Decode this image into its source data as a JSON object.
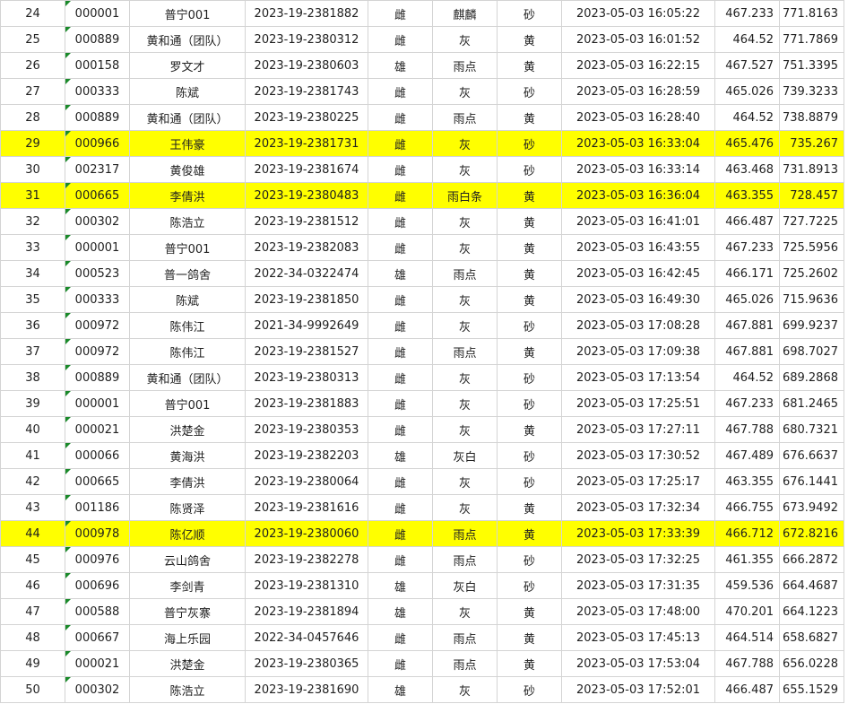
{
  "sheet": {
    "highlight_color": "#ffff00",
    "rows": [
      {
        "rank": "24",
        "id": "000001",
        "name": "普宁001",
        "ring": "2023-19-2381882",
        "sex": "雌",
        "color": "麒麟",
        "eye": "砂",
        "time": "2023-05-03  16:05:22",
        "distance": "467.233",
        "speed": "771.8163",
        "highlight": false
      },
      {
        "rank": "25",
        "id": "000889",
        "name": "黄和通（团队）",
        "ring": "2023-19-2380312",
        "sex": "雌",
        "color": "灰",
        "eye": "黄",
        "time": "2023-05-03  16:01:52",
        "distance": "464.52",
        "speed": "771.7869",
        "highlight": false
      },
      {
        "rank": "26",
        "id": "000158",
        "name": "罗文才",
        "ring": "2023-19-2380603",
        "sex": "雄",
        "color": "雨点",
        "eye": "黄",
        "time": "2023-05-03  16:22:15",
        "distance": "467.527",
        "speed": "751.3395",
        "highlight": false
      },
      {
        "rank": "27",
        "id": "000333",
        "name": "陈斌",
        "ring": "2023-19-2381743",
        "sex": "雌",
        "color": "灰",
        "eye": "砂",
        "time": "2023-05-03  16:28:59",
        "distance": "465.026",
        "speed": "739.3233",
        "highlight": false
      },
      {
        "rank": "28",
        "id": "000889",
        "name": "黄和通（团队）",
        "ring": "2023-19-2380225",
        "sex": "雌",
        "color": "雨点",
        "eye": "黄",
        "time": "2023-05-03  16:28:40",
        "distance": "464.52",
        "speed": "738.8879",
        "highlight": false
      },
      {
        "rank": "29",
        "id": "000966",
        "name": "王伟豪",
        "ring": "2023-19-2381731",
        "sex": "雌",
        "color": "灰",
        "eye": "砂",
        "time": "2023-05-03  16:33:04",
        "distance": "465.476",
        "speed": "735.267",
        "highlight": true
      },
      {
        "rank": "30",
        "id": "002317",
        "name": "黄俊雄",
        "ring": "2023-19-2381674",
        "sex": "雌",
        "color": "灰",
        "eye": "砂",
        "time": "2023-05-03  16:33:14",
        "distance": "463.468",
        "speed": "731.8913",
        "highlight": false
      },
      {
        "rank": "31",
        "id": "000665",
        "name": "李倩洪",
        "ring": "2023-19-2380483",
        "sex": "雌",
        "color": "雨白条",
        "eye": "黄",
        "time": "2023-05-03  16:36:04",
        "distance": "463.355",
        "speed": "728.457",
        "highlight": true
      },
      {
        "rank": "32",
        "id": "000302",
        "name": "陈浩立",
        "ring": "2023-19-2381512",
        "sex": "雌",
        "color": "灰",
        "eye": "黄",
        "time": "2023-05-03  16:41:01",
        "distance": "466.487",
        "speed": "727.7225",
        "highlight": false
      },
      {
        "rank": "33",
        "id": "000001",
        "name": "普宁001",
        "ring": "2023-19-2382083",
        "sex": "雌",
        "color": "灰",
        "eye": "黄",
        "time": "2023-05-03  16:43:55",
        "distance": "467.233",
        "speed": "725.5956",
        "highlight": false
      },
      {
        "rank": "34",
        "id": "000523",
        "name": "普一鸽舍",
        "ring": "2022-34-0322474",
        "sex": "雄",
        "color": "雨点",
        "eye": "黄",
        "time": "2023-05-03  16:42:45",
        "distance": "466.171",
        "speed": "725.2602",
        "highlight": false
      },
      {
        "rank": "35",
        "id": "000333",
        "name": "陈斌",
        "ring": "2023-19-2381850",
        "sex": "雌",
        "color": "灰",
        "eye": "黄",
        "time": "2023-05-03  16:49:30",
        "distance": "465.026",
        "speed": "715.9636",
        "highlight": false
      },
      {
        "rank": "36",
        "id": "000972",
        "name": "陈伟江",
        "ring": "2021-34-9992649",
        "sex": "雌",
        "color": "灰",
        "eye": "砂",
        "time": "2023-05-03  17:08:28",
        "distance": "467.881",
        "speed": "699.9237",
        "highlight": false
      },
      {
        "rank": "37",
        "id": "000972",
        "name": "陈伟江",
        "ring": "2023-19-2381527",
        "sex": "雌",
        "color": "雨点",
        "eye": "黄",
        "time": "2023-05-03  17:09:38",
        "distance": "467.881",
        "speed": "698.7027",
        "highlight": false
      },
      {
        "rank": "38",
        "id": "000889",
        "name": "黄和通（团队）",
        "ring": "2023-19-2380313",
        "sex": "雌",
        "color": "灰",
        "eye": "砂",
        "time": "2023-05-03  17:13:54",
        "distance": "464.52",
        "speed": "689.2868",
        "highlight": false
      },
      {
        "rank": "39",
        "id": "000001",
        "name": "普宁001",
        "ring": "2023-19-2381883",
        "sex": "雌",
        "color": "灰",
        "eye": "砂",
        "time": "2023-05-03  17:25:51",
        "distance": "467.233",
        "speed": "681.2465",
        "highlight": false
      },
      {
        "rank": "40",
        "id": "000021",
        "name": "洪楚金",
        "ring": "2023-19-2380353",
        "sex": "雌",
        "color": "灰",
        "eye": "黄",
        "time": "2023-05-03  17:27:11",
        "distance": "467.788",
        "speed": "680.7321",
        "highlight": false
      },
      {
        "rank": "41",
        "id": "000066",
        "name": "黄海洪",
        "ring": "2023-19-2382203",
        "sex": "雄",
        "color": "灰白",
        "eye": "砂",
        "time": "2023-05-03  17:30:52",
        "distance": "467.489",
        "speed": "676.6637",
        "highlight": false
      },
      {
        "rank": "42",
        "id": "000665",
        "name": "李倩洪",
        "ring": "2023-19-2380064",
        "sex": "雌",
        "color": "灰",
        "eye": "砂",
        "time": "2023-05-03  17:25:17",
        "distance": "463.355",
        "speed": "676.1441",
        "highlight": false
      },
      {
        "rank": "43",
        "id": "001186",
        "name": "陈贤泽",
        "ring": "2023-19-2381616",
        "sex": "雌",
        "color": "灰",
        "eye": "黄",
        "time": "2023-05-03  17:32:34",
        "distance": "466.755",
        "speed": "673.9492",
        "highlight": false
      },
      {
        "rank": "44",
        "id": "000978",
        "name": "陈亿顺",
        "ring": "2023-19-2380060",
        "sex": "雌",
        "color": "雨点",
        "eye": "黄",
        "time": "2023-05-03  17:33:39",
        "distance": "466.712",
        "speed": "672.8216",
        "highlight": true
      },
      {
        "rank": "45",
        "id": "000976",
        "name": "云山鸽舍",
        "ring": "2023-19-2382278",
        "sex": "雌",
        "color": "雨点",
        "eye": "砂",
        "time": "2023-05-03  17:32:25",
        "distance": "461.355",
        "speed": "666.2872",
        "highlight": false
      },
      {
        "rank": "46",
        "id": "000696",
        "name": "李剑青",
        "ring": "2023-19-2381310",
        "sex": "雄",
        "color": "灰白",
        "eye": "砂",
        "time": "2023-05-03  17:31:35",
        "distance": "459.536",
        "speed": "664.4687",
        "highlight": false
      },
      {
        "rank": "47",
        "id": "000588",
        "name": "普宁灰寨",
        "ring": "2023-19-2381894",
        "sex": "雄",
        "color": "灰",
        "eye": "黄",
        "time": "2023-05-03  17:48:00",
        "distance": "470.201",
        "speed": "664.1223",
        "highlight": false
      },
      {
        "rank": "48",
        "id": "000667",
        "name": "海上乐园",
        "ring": "2022-34-0457646",
        "sex": "雌",
        "color": "雨点",
        "eye": "黄",
        "time": "2023-05-03  17:45:13",
        "distance": "464.514",
        "speed": "658.6827",
        "highlight": false
      },
      {
        "rank": "49",
        "id": "000021",
        "name": "洪楚金",
        "ring": "2023-19-2380365",
        "sex": "雌",
        "color": "雨点",
        "eye": "黄",
        "time": "2023-05-03  17:53:04",
        "distance": "467.788",
        "speed": "656.0228",
        "highlight": false
      },
      {
        "rank": "50",
        "id": "000302",
        "name": "陈浩立",
        "ring": "2023-19-2381690",
        "sex": "雄",
        "color": "灰",
        "eye": "砂",
        "time": "2023-05-03  17:52:01",
        "distance": "466.487",
        "speed": "655.1529",
        "highlight": false
      }
    ]
  }
}
